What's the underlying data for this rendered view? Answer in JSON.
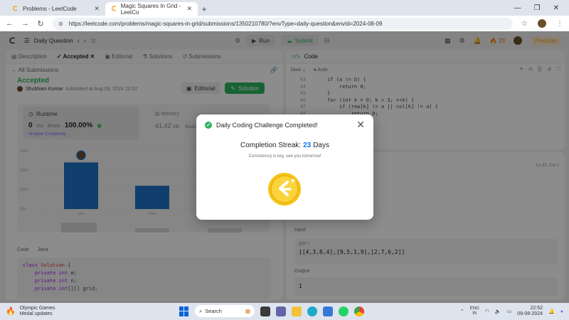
{
  "browser": {
    "tabs": [
      {
        "title": "Problems - LeetCode"
      },
      {
        "title": "Magic Squares In Grid - LeetCo"
      }
    ],
    "url": "https://leetcode.com/problems/magic-squares-in-grid/submissions/1350210780/?envType=daily-question&envId=2024-08-09"
  },
  "header": {
    "daily_question": "Daily Question",
    "run": "Run",
    "submit": "Submit",
    "streak_count": "23",
    "premium": "Premium"
  },
  "left": {
    "tabs": [
      "Description",
      "Accepted",
      "Editorial",
      "Solutions",
      "Submissions"
    ],
    "all_submissions": "All Submissions",
    "status": "Accepted",
    "user": "Shubham Kumar",
    "submitted_at": "submitted at Aug 09, 2024 22:52",
    "editorial_btn": "Editorial",
    "solution_btn": "Solution",
    "runtime_label": "Runtime",
    "runtime_value": "0",
    "runtime_unit": "ms",
    "beats_label": "Beats",
    "beats_value": "100.00%",
    "analyze": "Analyze Complexity",
    "memory_label": "Memory",
    "memory_value": "41.42",
    "memory_unit": "MB",
    "memory_beats": "Beats",
    "code_label": "Code",
    "code_lang": "Java",
    "code_lines": [
      "class Solution {",
      "    private int m;",
      "    private int n;",
      "    private int[][] grid;"
    ]
  },
  "chart_data": {
    "type": "bar",
    "y_ticks": [
      "75%",
      "50%",
      "25%",
      "0%"
    ],
    "x_labels": [
      "1ms",
      "10ms",
      "20ms"
    ],
    "values": [
      60,
      30
    ],
    "ylim": [
      0,
      75
    ]
  },
  "right": {
    "code_tab": "Code",
    "lang": "Java",
    "auto": "Auto",
    "line_numbers": [
      "43",
      "44",
      "45",
      "46",
      "47",
      "48"
    ],
    "lines": [
      "if (a != b) {",
      "    return 0;",
      "}",
      "for (int k = 0; k < 3; ++k) {",
      "    if (row[k] != a || col[k] != a) {",
      "        return 0;"
    ],
    "cursor": "Ln 32, Col 1",
    "input_label": "Input",
    "grid_name": "grid =",
    "grid_value": "[[4,3,8,4],[9,5,1,9],[2,7,6,2]]",
    "output_label": "Output",
    "output_value": "1"
  },
  "modal": {
    "title": "Daily Coding Challenge Completed!",
    "streak_label": "Completion Streak:",
    "streak_days": "23",
    "days_word": "Days",
    "subtitle": "Consistency is key, see you tomorrow!"
  },
  "taskbar": {
    "weather_title": "Olympic Games",
    "weather_sub": "Medal updates",
    "search": "Search",
    "lang1": "ENG",
    "lang2": "IN",
    "time": "22:52",
    "date": "09-08-2024"
  }
}
